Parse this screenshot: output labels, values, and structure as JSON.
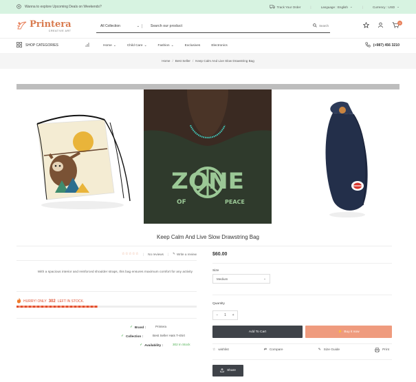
{
  "announcement": {
    "text": "Wanna to explore Upcoming Deals on Weekends?",
    "track_order": "Track Your Order",
    "language": "Language : English",
    "currency": "Currency : USD"
  },
  "header": {
    "brand": "Printera",
    "tagline": "CREATIVE ART",
    "collection_select": "All Collection",
    "search_placeholder": "Search our product",
    "search_button": "Search",
    "cart_count": "0"
  },
  "nav": {
    "shop_categories": "SHOP CATEGORIES",
    "items": [
      "Home",
      "Child Care",
      "Fashion",
      "Exclusives",
      "Electronics"
    ],
    "phone": "(+987) 456 3210"
  },
  "breadcrumb": [
    "Home",
    "Best Seller",
    "Keep Calm And Live Slow Drawstring Bag"
  ],
  "gallery": {
    "tshirt_text_top": "ZONE",
    "tshirt_text_left": "OF",
    "tshirt_text_right": "PEACE"
  },
  "product": {
    "title": "Keep Calm And Live Slow Drawstring Bag",
    "reviews": "No reviews",
    "write_review": "Write a review",
    "description": "With a spacious interior and reinforced shoulder straps, this bag ensures maximum comfort for any activity",
    "hurry_prefix": "HURRY! ONLY",
    "hurry_count": "302",
    "hurry_suffix": "LEFT IN STOCK.",
    "stock_fraction": 0.45,
    "brand_label": "Brand :",
    "brand_value": "Printera",
    "collection_label": "Collection :",
    "collection_value": "Best Seller Hats T-shirt",
    "availability_label": "Availability :",
    "availability_value": "302 In Stock",
    "price": "$60.00",
    "size_label": "Size",
    "size_value": "Medium",
    "quantity_label": "Quantity",
    "quantity_value": "1",
    "add_to_cart": "Add To Cart",
    "buy_now": "Buy it now",
    "wishlist": "wishlist",
    "compare": "Compare",
    "size_guide": "Size Guide",
    "print": "Print",
    "share": "Share"
  },
  "colors": {
    "accent": "#e8805a",
    "announcement_bg": "#d7f3e1",
    "dark_button": "#3f4349",
    "buy_now": "#ef9b7e",
    "stock_red": "#e04d2d",
    "in_stock_green": "#4caf50"
  }
}
